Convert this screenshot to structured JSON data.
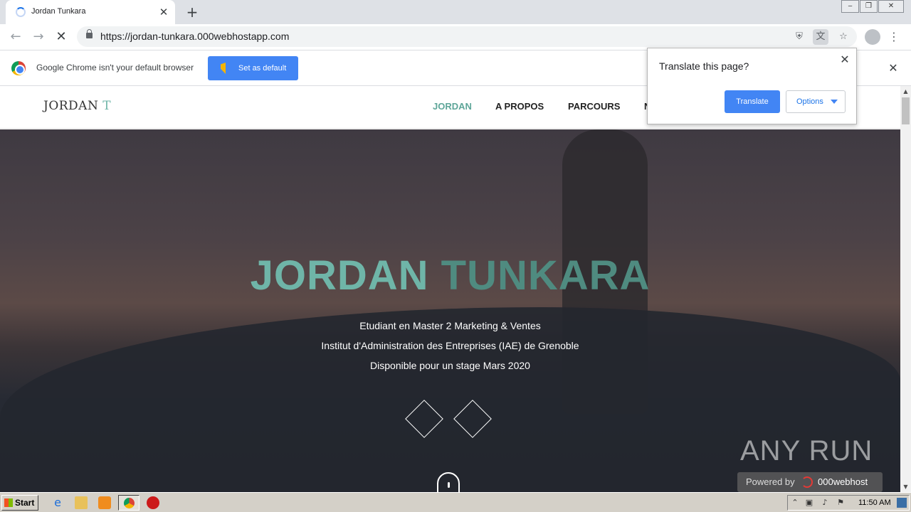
{
  "browser": {
    "tab_title": "Jordan Tunkara",
    "url": "https://jordan-tunkara.000webhostapp.com",
    "infobar_text": "Google Chrome isn't your default browser",
    "set_default_label": "Set as default"
  },
  "translate_popup": {
    "title": "Translate this page?",
    "translate_label": "Translate",
    "options_label": "Options"
  },
  "site": {
    "logo_main": "JORDAN",
    "logo_accent": "T",
    "nav": [
      "JORDAN",
      "A PROPOS",
      "PARCOURS",
      "N"
    ],
    "hero_first": "JORDAN",
    "hero_last": "TUNKARA",
    "hero_lines": [
      "Etudiant en Master 2 Marketing & Ventes",
      "Institut d'Administration des Entreprises (IAE) de Grenoble",
      "Disponible pour un stage Mars 2020"
    ]
  },
  "watermark": {
    "anyrun": "ANY RUN",
    "powered_by": "Powered by",
    "host_name": "000webhost"
  },
  "taskbar": {
    "start_label": "Start",
    "clock": "11:50 AM"
  },
  "colors": {
    "accent_teal": "#6fb5a8",
    "chrome_blue": "#4285f4"
  }
}
